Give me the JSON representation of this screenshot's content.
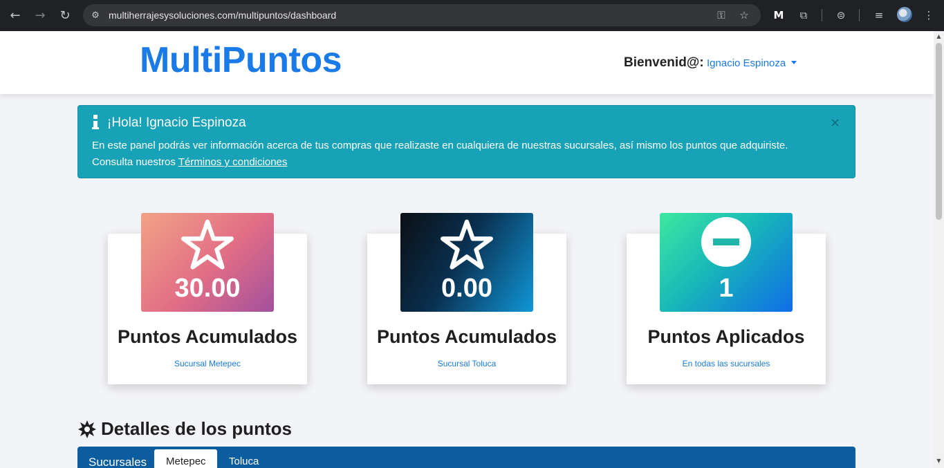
{
  "browser": {
    "url": "multiherrajesysoluciones.com/multipuntos/dashboard"
  },
  "header": {
    "brand": "MultiPuntos",
    "welcome_label": "Bienvenid@:",
    "user_name": "Ignacio Espinoza"
  },
  "alert": {
    "title": "¡Hola! Ignacio Espinoza",
    "close_symbol": "×",
    "body_line1": "En este panel podrás ver información acerca de tus compras que realizaste en cualquiera de nuestras sucursales, así mismo los puntos que adquiriste.",
    "body_line2_prefix": "Consulta nuestros ",
    "terms_link": "Términos y condiciones"
  },
  "cards": [
    {
      "value": "30.00",
      "label": "Puntos Acumulados",
      "sub": "Sucursal Metepec",
      "icon": "star-icon"
    },
    {
      "value": "0.00",
      "label": "Puntos Acumulados",
      "sub": "Sucursal Toluca",
      "icon": "star-icon"
    },
    {
      "value": "1",
      "label": "Puntos Aplicados",
      "sub": "En todas las sucursales",
      "icon": "minus-circle-icon"
    }
  ],
  "details": {
    "title": "Detalles de los puntos",
    "tabs_label": "Sucursales",
    "tabs": [
      "Metepec",
      "Toluca"
    ]
  },
  "colors": {
    "brand": "#1a7ae8",
    "alert_bg": "#17a2b8",
    "tabs_bg": "#0b5da0"
  }
}
